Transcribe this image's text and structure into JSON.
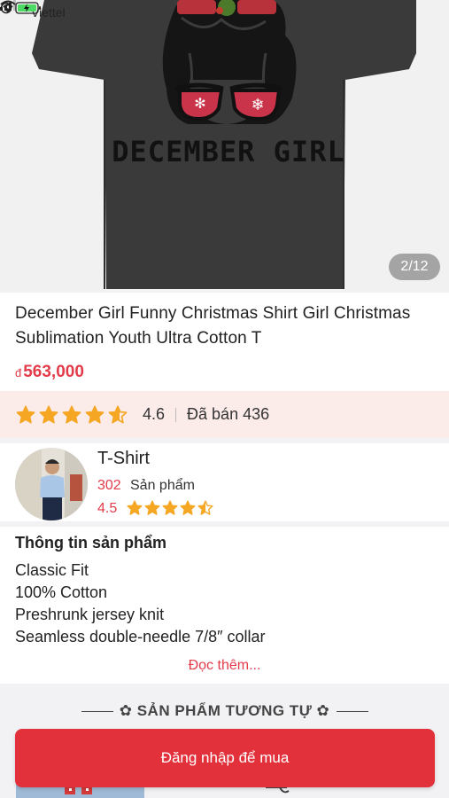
{
  "status_bar": {
    "carrier": "Viettel"
  },
  "gallery": {
    "counter": "2/12",
    "print_text": "DECEMBER GIRL"
  },
  "product": {
    "title": "December Girl Funny Christmas Shirt Girl Christmas Sublimation Youth Ultra Cotton T",
    "currency_symbol": "đ",
    "price": "563,000",
    "rating": "4.6",
    "rating_stars": 4.6,
    "sold": "Đã bán 436"
  },
  "shop": {
    "name": "T-Shirt",
    "product_count": "302",
    "product_count_label": "Sản phẩm",
    "rating": "4.5",
    "rating_stars": 4.5
  },
  "info": {
    "heading": "Thông tin sản phẩm",
    "lines": [
      "Classic Fit",
      "100% Cotton",
      "Preshrunk jersey knit",
      "Seamless double-needle 7/8″ collar"
    ],
    "read_more": "Đọc thêm..."
  },
  "similar": {
    "heading": "✿ SẢN PHẨM TƯƠNG TỰ ✿"
  },
  "buy_button": {
    "label": "Đăng nhập để mua"
  },
  "colors": {
    "accent": "#e3313b",
    "price": "#e33b4a",
    "star": "#f5a623",
    "rating_bg": "#fbecea"
  }
}
